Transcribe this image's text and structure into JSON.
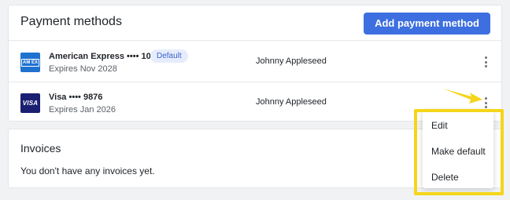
{
  "payment": {
    "title": "Payment methods",
    "add_button": "Add payment method",
    "cards": [
      {
        "brand_icon": "amex-logo-icon",
        "logo_text": "AM EX",
        "name": "American Express •••• 1009",
        "badge": "Default",
        "expiry": "Expires Nov 2028",
        "holder": "Johnny Appleseed"
      },
      {
        "brand_icon": "visa-logo-icon",
        "logo_text": "VISA",
        "name": "Visa •••• 9876",
        "expiry": "Expires Jan 2026",
        "holder": "Johnny Appleseed"
      }
    ]
  },
  "invoices": {
    "title": "Invoices",
    "empty_text": "You don't have any invoices yet."
  },
  "context_menu": {
    "items": [
      "Edit",
      "Make default",
      "Delete"
    ]
  },
  "colors": {
    "accent": "#3d6fe0",
    "highlight": "#f5d51a",
    "badge_bg": "#e6ecfb"
  }
}
